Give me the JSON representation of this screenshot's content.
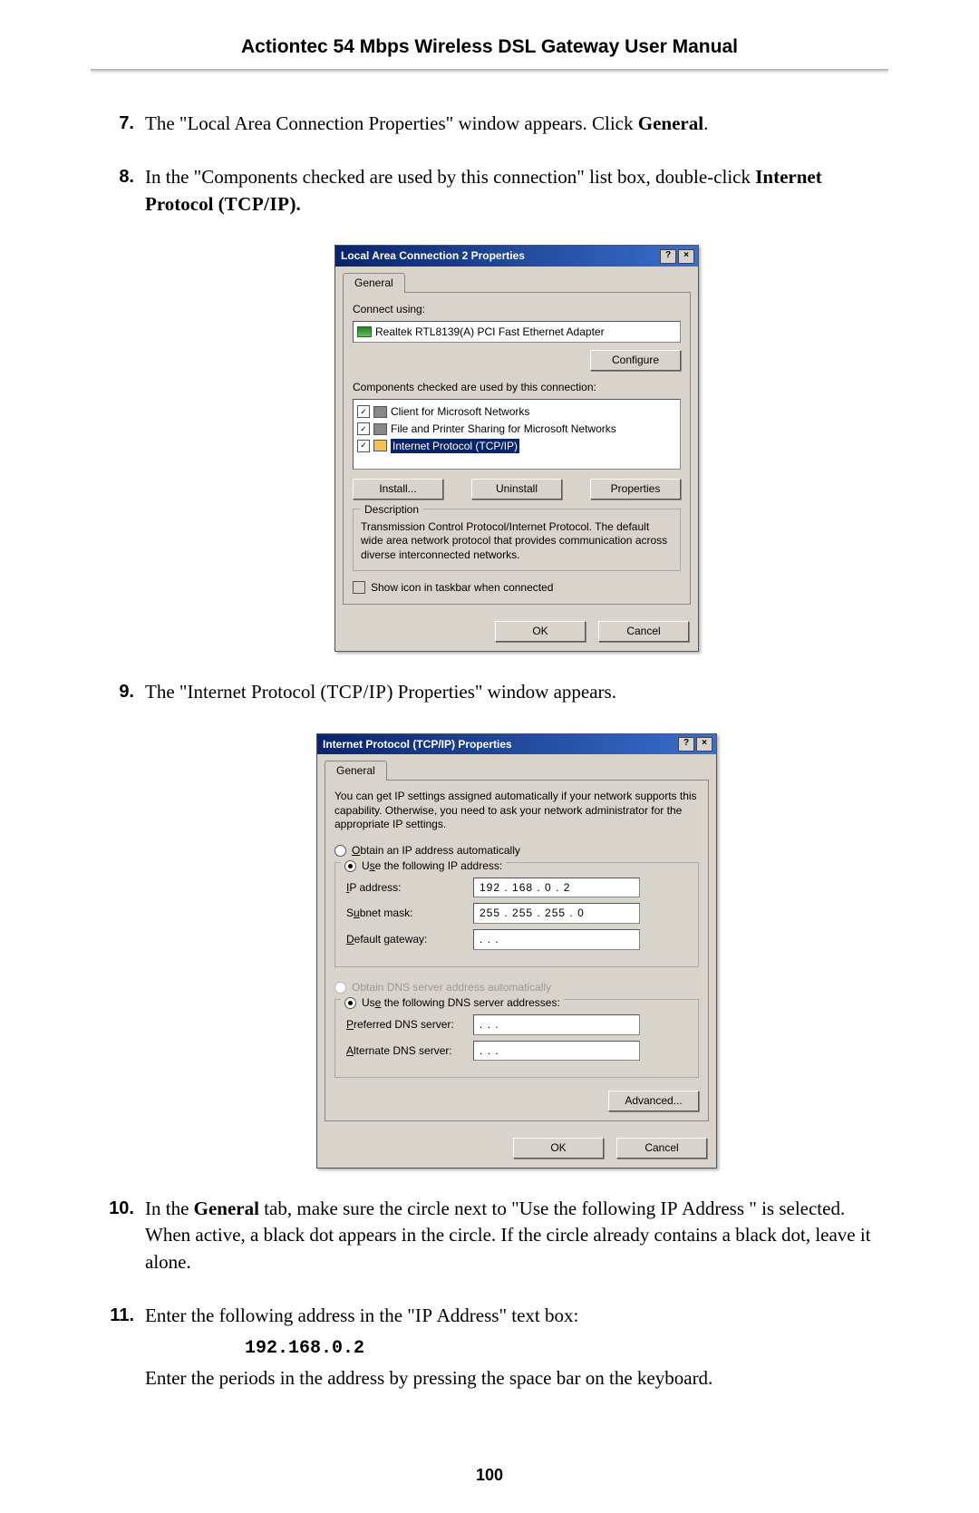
{
  "header": {
    "title": "Actiontec 54 Mbps Wireless DSL Gateway User Manual"
  },
  "steps": {
    "s7": {
      "num": "7.",
      "text_a": "The \"Local Area Connection Properties\" window appears. Click ",
      "bold": "General",
      "text_b": "."
    },
    "s8": {
      "num": "8.",
      "text_a": "In the \"Components checked are used by this connection\" list box, double-click ",
      "bold": "Internet Protocol (",
      "sc": "TCP/IP",
      "text_b": ")."
    },
    "s9": {
      "num": "9.",
      "text_a": "The \"Internet Protocol (",
      "sc": "TCP/IP",
      "text_b": ") Properties\" window appears."
    },
    "s10": {
      "num": "10.",
      "text_a": "In the ",
      "bold": "General",
      "text_b": " tab, make sure the circle next to \"Use the following ",
      "sc": "IP",
      "text_c": " Address \" is selected. When active, a black dot appears in the circle. If the circle already contains a black dot, leave it alone."
    },
    "s11": {
      "num": "11.",
      "text_a": "Enter the following address in the \"",
      "sc": "IP",
      "text_b": " Address\" text box:",
      "ip": "192.168.0.2",
      "text_c": "Enter the periods in the address by pressing the space bar on the keyboard."
    }
  },
  "page_number": "100",
  "dialog1": {
    "title": "Local Area Connection 2 Properties",
    "tab": "General",
    "connect_using": "Connect using:",
    "adapter": "Realtek RTL8139(A) PCI Fast Ethernet Adapter",
    "configure": "Configure",
    "components_label": "Components checked are used by this connection:",
    "items": [
      "Client for Microsoft Networks",
      "File and Printer Sharing for Microsoft Networks",
      "Internet Protocol (TCP/IP)"
    ],
    "install": "Install...",
    "uninstall": "Uninstall",
    "properties": "Properties",
    "description_label": "Description",
    "description": "Transmission Control Protocol/Internet Protocol. The default wide area network protocol that provides communication across diverse interconnected networks.",
    "show_icon": "Show icon in taskbar when connected",
    "ok": "OK",
    "cancel": "Cancel"
  },
  "dialog2": {
    "title": "Internet Protocol (TCP/IP) Properties",
    "tab": "General",
    "help": "You can get IP settings assigned automatically if your network supports this capability. Otherwise, you need to ask your network administrator for the appropriate IP settings.",
    "obtain_auto": "Obtain an IP address automatically",
    "use_ip": "Use the following IP address:",
    "ip_label": "IP address:",
    "ip_value": "192 . 168 .  0  .  2",
    "subnet_label": "Subnet mask:",
    "subnet_value": "255 . 255 . 255 .  0",
    "gateway_label": "Default gateway:",
    "gateway_value": " .       .       .",
    "obtain_dns_auto": "Obtain DNS server address automatically",
    "use_dns": "Use the following DNS server addresses:",
    "pref_dns": "Preferred DNS server:",
    "alt_dns": "Alternate DNS server:",
    "dns_blank": " .       .       .",
    "advanced": "Advanced...",
    "ok": "OK",
    "cancel": "Cancel"
  }
}
